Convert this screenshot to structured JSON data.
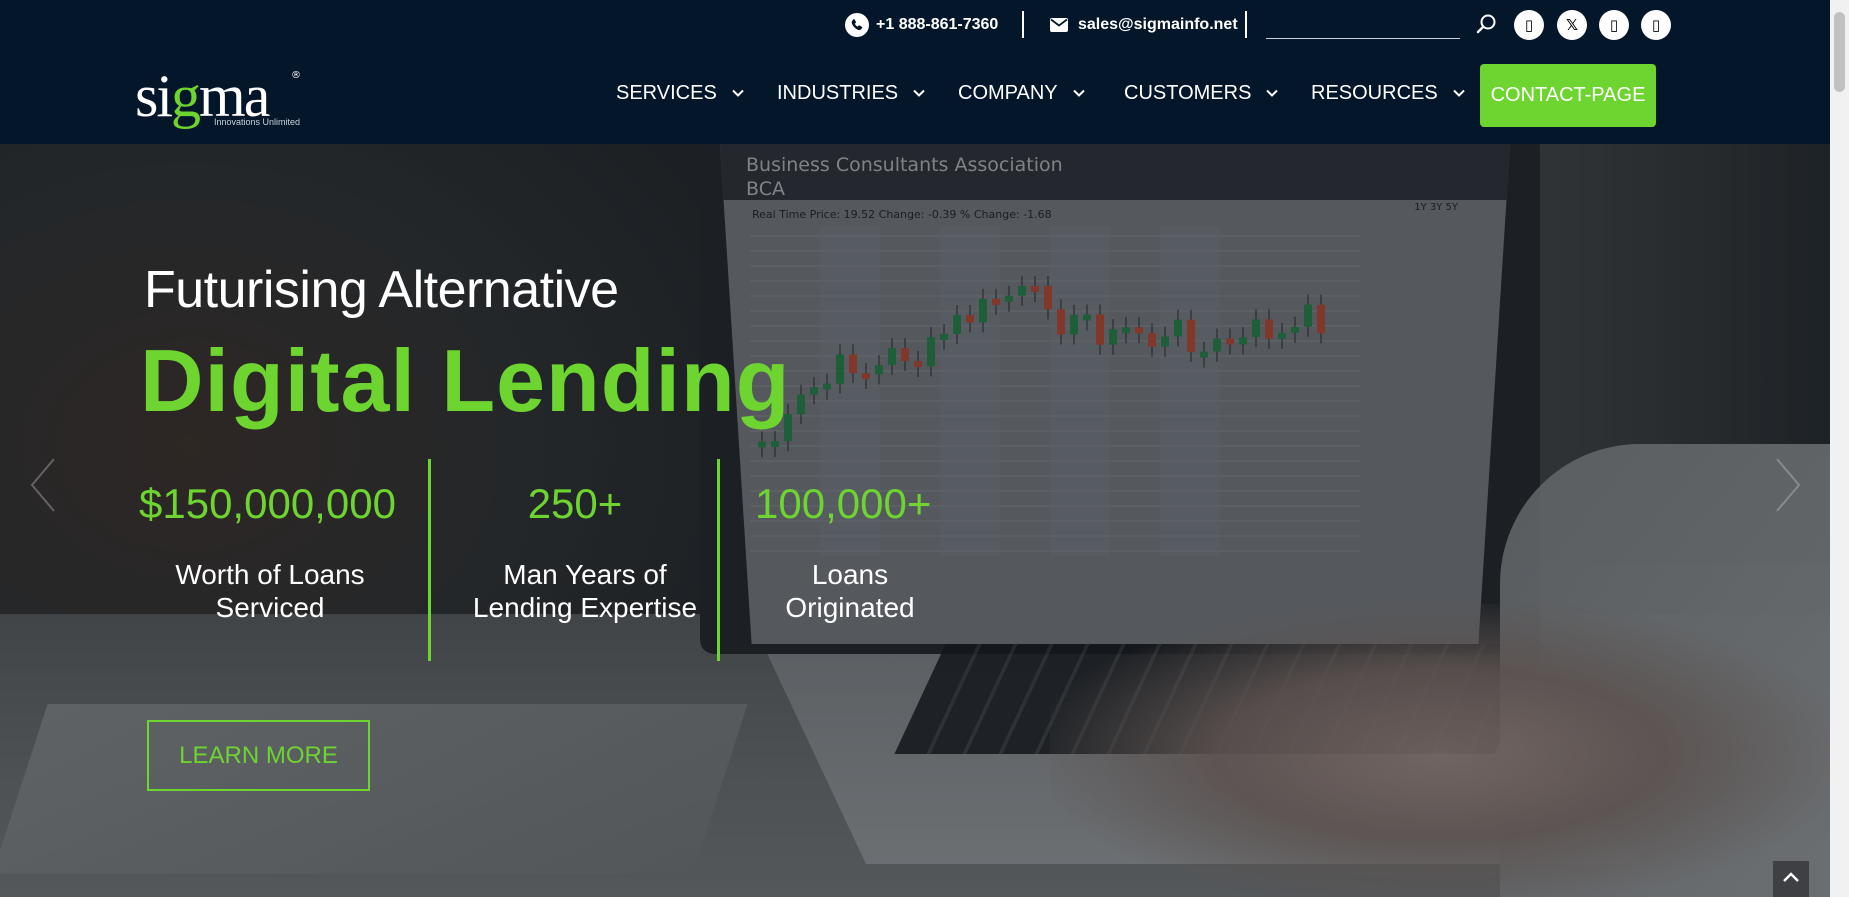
{
  "topbar": {
    "phone": "+1 888-861-7360",
    "email": "sales@sigmainfo.net",
    "search_placeholder": "",
    "social": [
      {
        "name": "facebook",
        "glyph": "▯"
      },
      {
        "name": "x-twitter",
        "glyph": "𝕏"
      },
      {
        "name": "linkedin",
        "glyph": "▯"
      },
      {
        "name": "youtube",
        "glyph": "▯"
      }
    ]
  },
  "logo": {
    "text_before": "si",
    "text_accent": "g",
    "text_after": "ma",
    "registered": "®",
    "tagline": "Innovations Unlimited"
  },
  "nav": {
    "items": [
      {
        "label": "SERVICES"
      },
      {
        "label": "INDUSTRIES"
      },
      {
        "label": "COMPANY"
      },
      {
        "label": "CUSTOMERS"
      },
      {
        "label": "RESOURCES"
      }
    ],
    "contact_label": "CONTACT-PAGE"
  },
  "hero": {
    "line1": "Futurising Alternative",
    "line2": "Digital Lending",
    "stats": [
      {
        "value": "$150,000,000",
        "label_line1": "Worth of Loans",
        "label_line2": "Serviced"
      },
      {
        "value": "250+",
        "label_line1": "Man Years of",
        "label_line2": "Lending Expertise"
      },
      {
        "value": "100,000+",
        "label_line1": "Loans",
        "label_line2": "Originated"
      }
    ],
    "cta": "LEARN MORE"
  },
  "laptop_screen": {
    "title_line1": "Business Consultants Association",
    "title_line2": "BCA",
    "stats_text": "Real Time Price:  19.52      Change:  -0.39      % Change:  -1.68",
    "ranges": "1Y   3Y   5Y"
  },
  "colors": {
    "accent": "#6dd430",
    "header_bg": "#03162a",
    "white": "#ffffff"
  },
  "icons": {
    "phone": "phone-icon",
    "email": "envelope-icon",
    "search": "search-icon",
    "chevron": "chevron-down-icon",
    "prev": "chevron-left-icon",
    "next": "chevron-right-icon",
    "scroll_top": "chevron-up-icon"
  }
}
